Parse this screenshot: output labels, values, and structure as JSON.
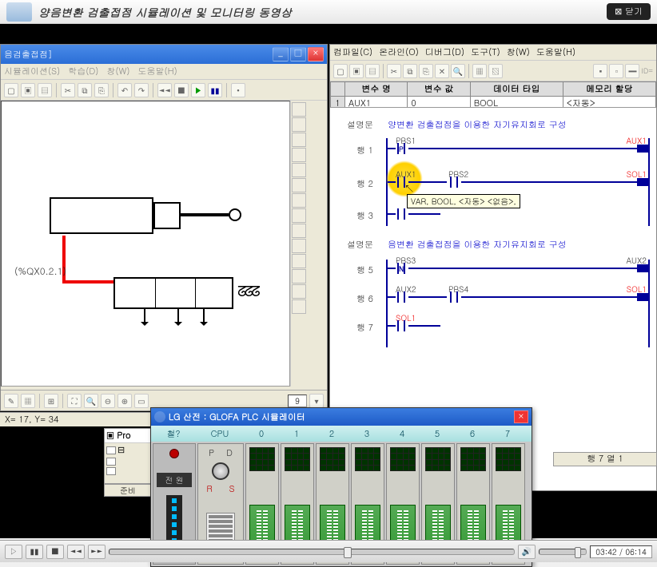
{
  "header": {
    "title": "양음변환 검출접점 시뮬레이션 및 모니터링 동영상",
    "close": "⊠ 닫기"
  },
  "left_win": {
    "title": "음검출접점]",
    "menus": [
      "시뮬레이션(S)",
      "학습(D)",
      "창(W)",
      "도움말(H)"
    ],
    "coord_label": "(%QX0.2.1)",
    "zoom_value": "9",
    "status": "X= 17, Y= 34"
  },
  "right_win": {
    "menus": [
      "컴파일(C)",
      "온라인(O)",
      "디버그(D)",
      "도구(T)",
      "창(W)",
      "도움말(H)"
    ],
    "var_table": {
      "headers": [
        "",
        "변수 명",
        "변수 값",
        "데이터 타입",
        "메모리 할당"
      ],
      "row": [
        "1",
        "AUX1",
        "0",
        "BOOL",
        "<자동>"
      ]
    },
    "rows": {
      "c1": "설명문",
      "c1_text": "양변환 검출접점을 이용한 자기유지회로 구성",
      "r1": "행 1",
      "r1_pbs1": "PBS1",
      "r1_aux1": "AUX1",
      "r2": "행 2",
      "r2_aux1": "AUX1",
      "r2_pbs2": "PBS2",
      "r2_sol1": "SOL1",
      "r3": "행 3",
      "c2": "설명문",
      "c2_text": "음변환 검출접점을 이용한 자기유지회로 구성",
      "r5": "행 5",
      "r5_pbs3": "PBS3",
      "r5_aux2": "AUX2",
      "r6": "행 6",
      "r6_aux2": "AUX2",
      "r6_pbs4": "PBS4",
      "r6_sol1": "SOL1",
      "r7": "행 7",
      "r7_sol1": "SOL1"
    },
    "tooltip": "VAR, BOOL, <자동> <없음>,",
    "status": "행 7 열 1"
  },
  "proj": {
    "title": "Pro"
  },
  "ready": "준비",
  "sim": {
    "title": "LG 산전 : GLOFA PLC 시뮬레이터",
    "headers": [
      "철?",
      "CPU",
      "0",
      "1",
      "2",
      "3",
      "4",
      "5",
      "6",
      "7"
    ],
    "power_label": "전 원",
    "cpu": {
      "p": "P",
      "d": "D",
      "r": "R",
      "s": "S"
    }
  },
  "media": {
    "time": "03:42 / 06:14"
  }
}
